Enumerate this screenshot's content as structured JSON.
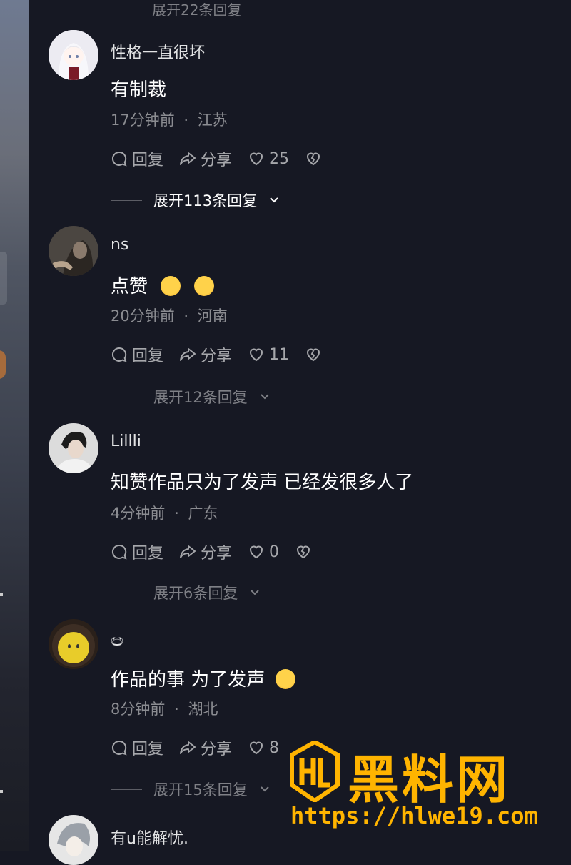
{
  "top_expand_label": "展开22条回复",
  "comments": [
    {
      "username": "性格一直很坏",
      "content": "有制裁",
      "time": "17分钟前",
      "location": "江苏",
      "reply_label": "回复",
      "share_label": "分享",
      "likes": "25",
      "expand_label": "展开113条回复"
    },
    {
      "username": "ns",
      "content": "点赞",
      "time": "20分钟前",
      "location": "河南",
      "reply_label": "回复",
      "share_label": "分享",
      "likes": "11",
      "expand_label": "展开12条回复"
    },
    {
      "username": "Lillli",
      "content": "知赞作品只为了发声 已经发很多人了",
      "time": "4分钟前",
      "location": "广东",
      "reply_label": "回复",
      "share_label": "分享",
      "likes": "0",
      "expand_label": "展开6条回复"
    },
    {
      "username": "ඏ",
      "content": "作品的事 为了发声",
      "time": "8分钟前",
      "location": "湖北",
      "reply_label": "回复",
      "share_label": "分享",
      "likes": "8",
      "expand_label": "展开15条回复"
    },
    {
      "username": "有u能解忧."
    }
  ],
  "separator": "·",
  "colors": {
    "background": "#161823",
    "watermark": "#ffb400"
  },
  "watermark": {
    "title": "黑料网",
    "url": "https://hlwe19.com"
  }
}
